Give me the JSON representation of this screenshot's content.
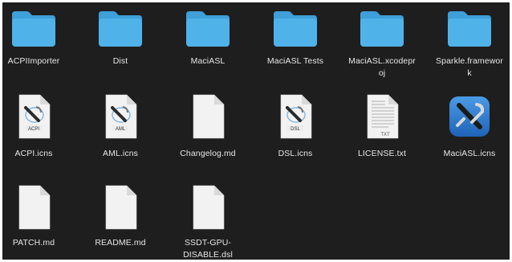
{
  "files": [
    {
      "name": "ACPIImporter",
      "kind": "folder"
    },
    {
      "name": "Dist",
      "kind": "folder"
    },
    {
      "name": "MaciASL",
      "kind": "folder"
    },
    {
      "name": "MaciASL Tests",
      "kind": "folder"
    },
    {
      "name": "MaciASL.xcodeproj",
      "kind": "folder",
      "label_lines": [
        "MaciASL.xcodepr",
        "oj"
      ]
    },
    {
      "name": "Sparkle.framework",
      "kind": "folder",
      "label_lines": [
        "Sparkle.framewor",
        "k"
      ]
    },
    {
      "name": "ACPI.icns",
      "kind": "icns",
      "badge": "ACPI"
    },
    {
      "name": "AML.icns",
      "kind": "icns",
      "badge": "AML"
    },
    {
      "name": "Changelog.md",
      "kind": "doc"
    },
    {
      "name": "DSL.icns",
      "kind": "icns",
      "badge": "DSL"
    },
    {
      "name": "LICENSE.txt",
      "kind": "txt",
      "badge": "TXT"
    },
    {
      "name": "MaciASL.icns",
      "kind": "app"
    },
    {
      "name": "PATCH.md",
      "kind": "doc"
    },
    {
      "name": "README.md",
      "kind": "doc"
    },
    {
      "name": "SSDT-GPU-DISABLE.dsl",
      "kind": "doc",
      "label_lines": [
        "SSDT-GPU-",
        "DISABLE.dsl"
      ]
    }
  ],
  "colors": {
    "window_background": "#1e1e1e",
    "folder_front": "#4fb3ea",
    "folder_tab": "#3f9fd8",
    "document": "#f2f2f2",
    "app_icon": "#2f7fd3",
    "label_text": "#e6e6e6"
  }
}
